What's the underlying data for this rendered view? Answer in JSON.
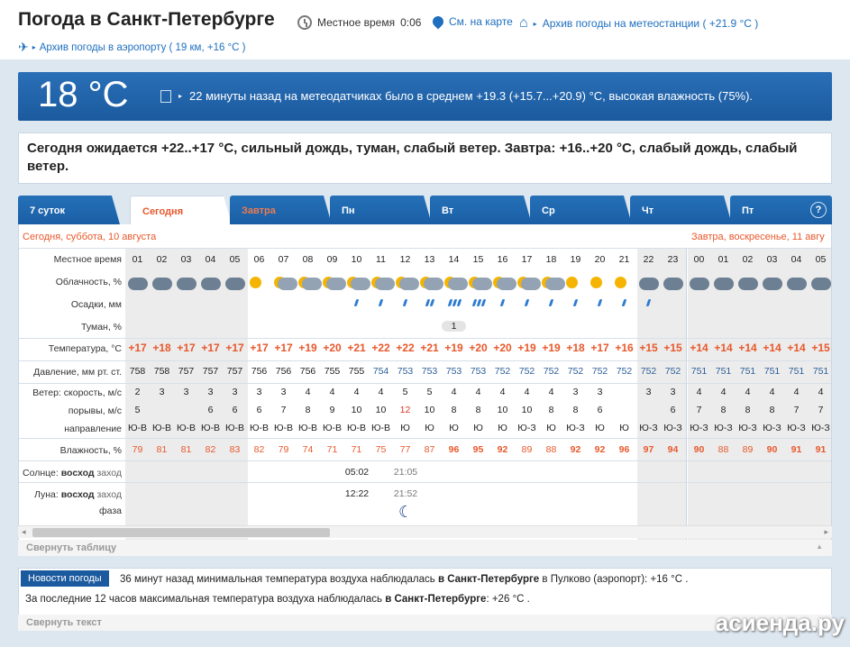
{
  "header": {
    "title": "Погода в Санкт-Петербурге",
    "local_time_label": "Местное время",
    "local_time": "0:06",
    "map_link": "См. на карте",
    "archive_station": "Архив погоды на метеостанции ( +21.9 °C )",
    "archive_airport": "Архив погоды в аэропорту ( 19 км, +16 °C )"
  },
  "banner": {
    "temperature": "18 °C",
    "message": "22 минуты назад на метеодатчиках было в среднем +19.3 (+15.7...+20.9) °C, высокая влажность (75%)."
  },
  "forecast_text": "Сегодня ожидается +22..+17 °C, сильный дождь, туман, слабый ветер. Завтра: +16..+20 °C, слабый дождь, слабый ветер.",
  "tabs": [
    "7 суток",
    "Сегодня",
    "Завтра",
    "Пн",
    "Вт",
    "Ср",
    "Чт",
    "Пт"
  ],
  "help": "?",
  "days": {
    "today": "Сегодня, суббота, 10 августа",
    "tomorrow": "Завтра, воскресенье, 11 авгу"
  },
  "labels": {
    "local_time": "Местное время",
    "cloudiness": "Облачность, %",
    "precip": "Осадки, мм",
    "fog": "Туман, %",
    "temperature": "Температура, °C",
    "pressure": "Давление, мм рт. ст.",
    "wind_speed": "Ветер: скорость, м/с",
    "gusts": "порывы, м/с",
    "direction": "направление",
    "humidity": "Влажность, %",
    "sun": "Солнце:",
    "sun_rise": "восход",
    "sun_set": "заход",
    "moon": "Луна:",
    "moon_rise": "восход",
    "moon_set": "заход",
    "phase": "фаза"
  },
  "hours": [
    "01",
    "02",
    "03",
    "04",
    "05",
    "06",
    "07",
    "08",
    "09",
    "10",
    "11",
    "12",
    "13",
    "14",
    "15",
    "16",
    "17",
    "18",
    "19",
    "20",
    "21",
    "22",
    "23",
    "00",
    "01",
    "02",
    "03",
    "04",
    "05"
  ],
  "fog_value": "1",
  "temperature": [
    "+17",
    "+18",
    "+17",
    "+17",
    "+17",
    "+17",
    "+17",
    "+19",
    "+20",
    "+21",
    "+22",
    "+22",
    "+21",
    "+19",
    "+20",
    "+20",
    "+19",
    "+19",
    "+18",
    "+17",
    "+16",
    "+15",
    "+15",
    "+14",
    "+14",
    "+14",
    "+14",
    "+14",
    "+15"
  ],
  "pressure": [
    "758",
    "758",
    "757",
    "757",
    "757",
    "756",
    "756",
    "756",
    "755",
    "755",
    "754",
    "753",
    "753",
    "753",
    "753",
    "752",
    "752",
    "752",
    "752",
    "752",
    "752",
    "752",
    "752",
    "751",
    "751",
    "751",
    "751",
    "751",
    "751"
  ],
  "wind_speed": [
    "2",
    "3",
    "3",
    "3",
    "3",
    "3",
    "3",
    "4",
    "4",
    "4",
    "4",
    "5",
    "5",
    "4",
    "4",
    "4",
    "4",
    "4",
    "3",
    "3",
    "",
    "3",
    "3",
    "4",
    "4",
    "4",
    "4",
    "4",
    "4"
  ],
  "gusts": [
    "5",
    "",
    "",
    "6",
    "6",
    "6",
    "7",
    "8",
    "9",
    "10",
    "10",
    "12",
    "10",
    "8",
    "8",
    "10",
    "10",
    "8",
    "8",
    "6",
    "",
    "",
    "6",
    "7",
    "8",
    "8",
    "8",
    "7",
    "7"
  ],
  "direction": [
    "Ю-В",
    "Ю-В",
    "Ю-В",
    "Ю-В",
    "Ю-В",
    "Ю-В",
    "Ю-В",
    "Ю-В",
    "Ю-В",
    "Ю-В",
    "Ю-В",
    "Ю",
    "Ю",
    "Ю",
    "Ю",
    "Ю",
    "Ю-З",
    "Ю",
    "Ю-З",
    "Ю",
    "Ю",
    "Ю-З",
    "Ю-З",
    "Ю-З",
    "Ю-З",
    "Ю-З",
    "Ю-З",
    "Ю-З",
    "Ю-З"
  ],
  "humidity": [
    "79",
    "81",
    "81",
    "82",
    "83",
    "82",
    "79",
    "74",
    "71",
    "71",
    "75",
    "77",
    "87",
    "96",
    "95",
    "92",
    "89",
    "88",
    "92",
    "92",
    "96",
    "97",
    "94",
    "90",
    "88",
    "89",
    "90",
    "91",
    "91"
  ],
  "sun": {
    "rise": "05:02",
    "set": "21:05"
  },
  "moon": {
    "rise": "12:22",
    "set": "21:52"
  },
  "collapse_table": "Свернуть таблицу",
  "news": {
    "tag": "Новости погоды",
    "line1_a": "36 минут назад минимальная температура воздуха наблюдалась",
    "line1_b": "в Санкт-Петербурге",
    "line1_c": "в Пулково (аэропорт): +16",
    "line1_unit": "°C .",
    "line2_a": "За последние 12 часов максимальная температура воздуха наблюдалась",
    "line2_b": "в Санкт-Петербурге",
    "line2_c": ": +26",
    "line2_unit": "°C ."
  },
  "collapse_text": "Свернуть текст",
  "logo": "асиенда.ру"
}
